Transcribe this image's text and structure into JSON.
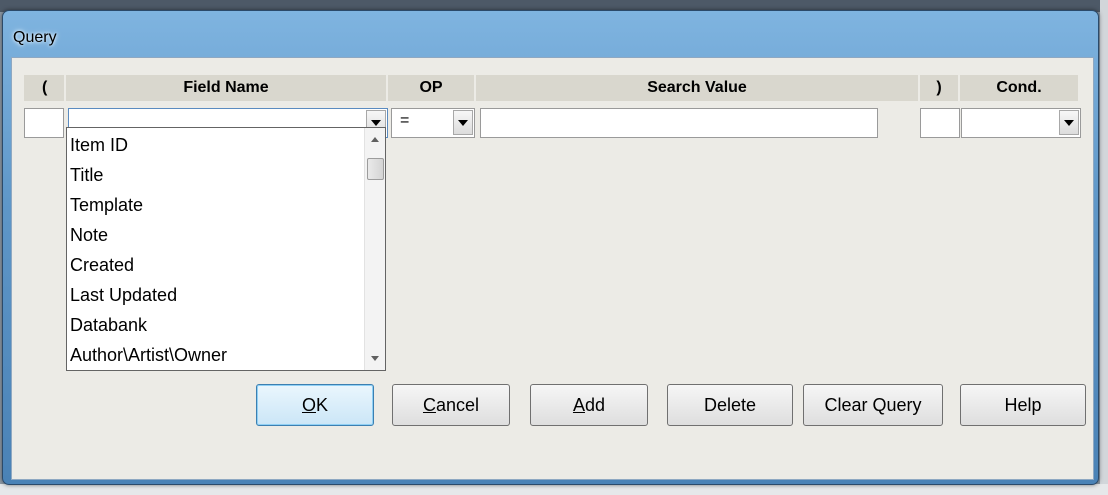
{
  "window": {
    "title": "Query"
  },
  "headers": {
    "open_paren": "(",
    "field_name": "Field Name",
    "op": "OP",
    "search_value": "Search Value",
    "close_paren": ")",
    "cond": "Cond."
  },
  "row": {
    "open_paren": "",
    "field_name": "",
    "op": "=",
    "search_value": "",
    "close_paren": "",
    "cond": ""
  },
  "field_list": {
    "items": [
      "Item ID",
      "Title",
      "Template",
      "Note",
      "Created",
      "Last Updated",
      "Databank",
      "Author\\Artist\\Owner"
    ]
  },
  "buttons": {
    "ok": {
      "hotkey": "O",
      "rest": "K"
    },
    "cancel": {
      "hotkey": "C",
      "rest": "ancel"
    },
    "add": {
      "hotkey": "A",
      "rest": "dd"
    },
    "delete": "Delete",
    "clear_query": "Clear Query",
    "help": "Help"
  }
}
